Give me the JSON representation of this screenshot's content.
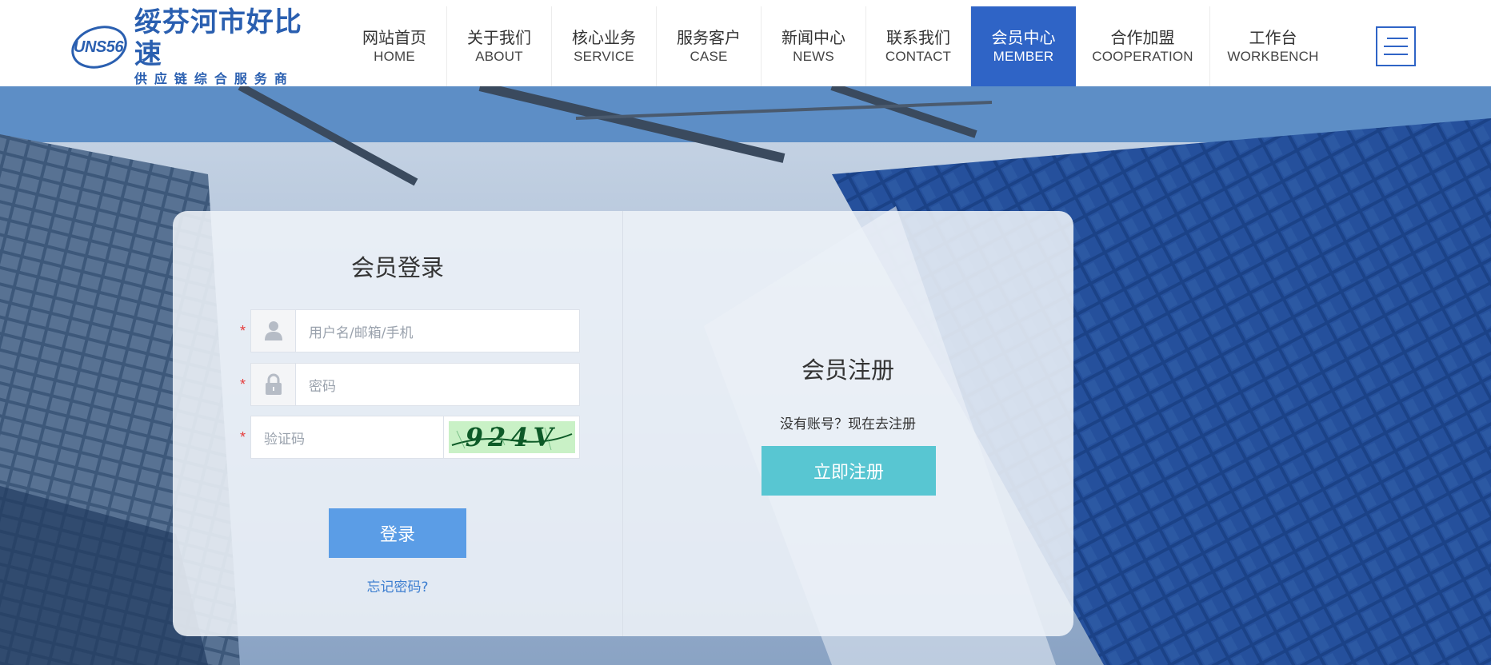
{
  "brand": {
    "mark_text": "UNS56",
    "title": "绥芬河市好比速",
    "subtitle": "供应链综合服务商",
    "color": "#2a5fb0"
  },
  "nav": {
    "items": [
      {
        "cn": "网站首页",
        "en": "HOME"
      },
      {
        "cn": "关于我们",
        "en": "ABOUT"
      },
      {
        "cn": "核心业务",
        "en": "SERVICE"
      },
      {
        "cn": "服务客户",
        "en": "CASE"
      },
      {
        "cn": "新闻中心",
        "en": "NEWS"
      },
      {
        "cn": "联系我们",
        "en": "CONTACT"
      },
      {
        "cn": "会员中心",
        "en": "MEMBER"
      },
      {
        "cn": "合作加盟",
        "en": "COOPERATION"
      },
      {
        "cn": "工作台",
        "en": "WORKBENCH"
      }
    ],
    "active_index": 6,
    "active_color": "#2f64c6",
    "menu_icon": "hamburger-menu-icon"
  },
  "login": {
    "title": "会员登录",
    "required_mark": "*",
    "username": {
      "placeholder": "用户名/邮箱/手机",
      "icon": "user-icon"
    },
    "password": {
      "placeholder": "密码",
      "icon": "lock-icon"
    },
    "captcha": {
      "placeholder": "验证码",
      "code": "924V"
    },
    "submit_label": "登录",
    "forgot_label": "忘记密码?",
    "submit_color": "#5b9de6"
  },
  "register": {
    "title": "会员注册",
    "description": "没有账号？现在去注册",
    "button_label": "立即注册",
    "button_color": "#58c6d2"
  }
}
